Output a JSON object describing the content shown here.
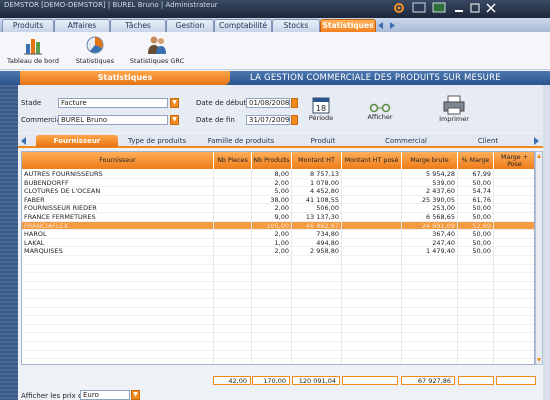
{
  "window": {
    "title": "DEMSTOR [DEMO-DEMSTOR] | BUREL Bruno | Administrateur"
  },
  "modules": [
    "Produits",
    "Affaires",
    "Tâches",
    "Gestion",
    "Comptabilité",
    "Stocks",
    "Statistiques"
  ],
  "toolbar": {
    "dashboard_label": "Tableau de bord",
    "stats_label": "Statistiques",
    "stats_grc_label": "Statistiques GRC"
  },
  "section": {
    "title": "Statistiques",
    "slogan": "LA GESTION COMMERCIALE DES PRODUITS SUR MESURE"
  },
  "filters": {
    "stade_label": "Stade",
    "stade_value": "Facture",
    "commercial_label": "Commercial",
    "commercial_value": "BUREL Bruno",
    "date_start_label": "Date de début",
    "date_start_value": "01/08/2008",
    "date_end_label": "Date de fin",
    "date_end_value": "31/07/2009",
    "period_label": "Période",
    "period_day": "18",
    "show_label": "Afficher",
    "print_label": "Imprimer"
  },
  "subtabs": [
    "Fournisseur",
    "Type de produits",
    "Famille de produits",
    "Produit",
    "Commercial",
    "Client"
  ],
  "table": {
    "columns": [
      "Fournisseur",
      "Nb Pieces",
      "Nb Produits",
      "Montant HT",
      "Montant HT posé",
      "Marge brute",
      "% Marge",
      "Marge + Pose"
    ],
    "rows": [
      [
        "AUTRES FOURNISSEURS",
        "",
        "8,00",
        "8 757,13",
        "",
        "5 954,28",
        "67,99",
        ""
      ],
      [
        "BUBENDORFF",
        "",
        "2,00",
        "1 078,00",
        "",
        "539,00",
        "50,00",
        ""
      ],
      [
        "CLOTURES DE L'OCEAN",
        "",
        "5,00",
        "4 452,80",
        "",
        "2 437,60",
        "54,74",
        ""
      ],
      [
        "FABER",
        "",
        "38,00",
        "41 108,55",
        "",
        "25 390,05",
        "61,76",
        ""
      ],
      [
        "FOURNISSEUR RIEDER",
        "",
        "2,00",
        "506,00",
        "",
        "253,00",
        "50,00",
        ""
      ],
      [
        "FRANCE FERMETURES",
        "",
        "9,00",
        "13 137,30",
        "",
        "6 568,65",
        "50,00",
        ""
      ],
      [
        "FRANCIAFLEX",
        "",
        "105,00",
        "46 862,87",
        "",
        "24 691,09",
        "52,69",
        ""
      ],
      [
        "HAROL",
        "",
        "2,00",
        "734,80",
        "",
        "367,40",
        "50,00",
        ""
      ],
      [
        "LAKAL",
        "",
        "1,00",
        "494,80",
        "",
        "247,40",
        "50,00",
        ""
      ],
      [
        "MARQUISES",
        "",
        "2,00",
        "2 958,80",
        "",
        "1 479,40",
        "50,00",
        ""
      ]
    ],
    "selected_index": 6
  },
  "totals": {
    "nb_pieces": "42,00",
    "nb_produits": "170,00",
    "montant_ht": "120 091,04",
    "marge_brute": "67 927,86"
  },
  "footer": {
    "price_label": "Afficher les prix en",
    "currency": "Euro"
  },
  "colors": {
    "accent": "#f08a1c",
    "header_blue": "#2b548d",
    "selected_row": "#f49a40"
  }
}
